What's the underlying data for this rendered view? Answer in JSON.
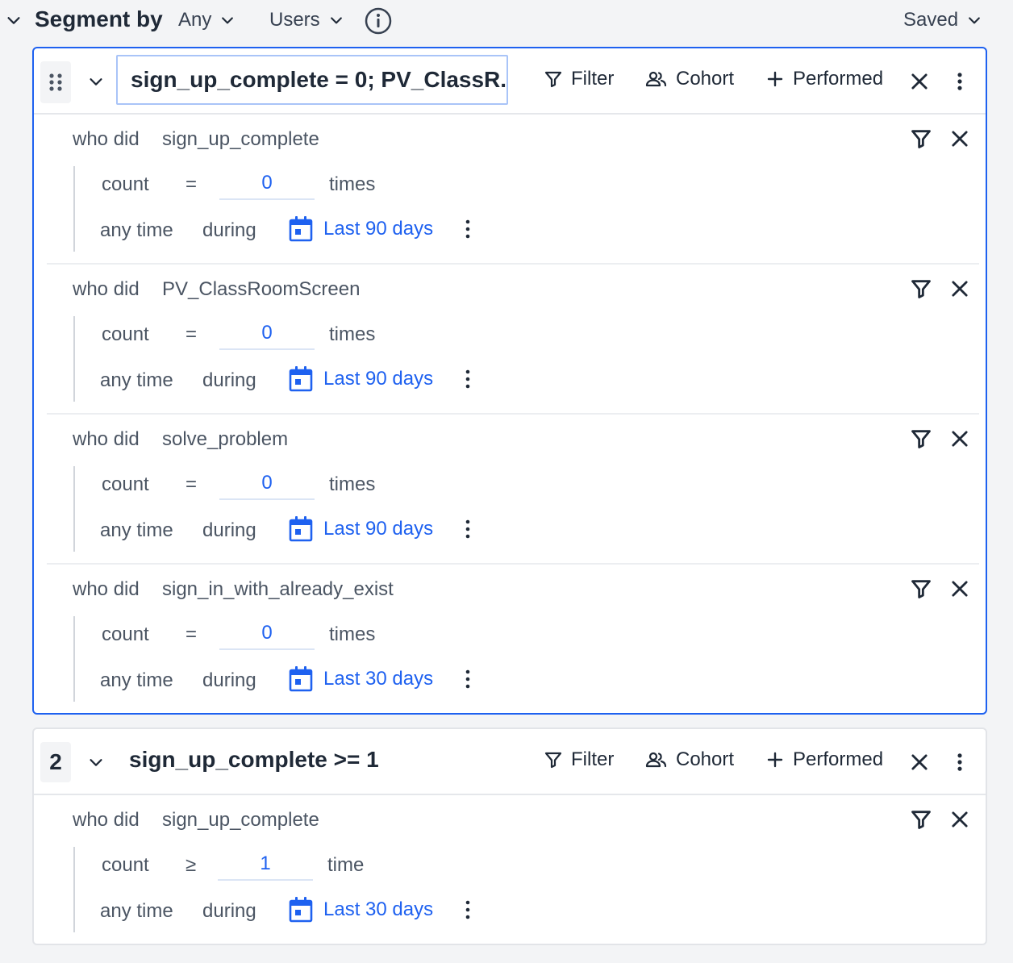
{
  "header": {
    "title": "Segment by",
    "any_label": "Any",
    "users_label": "Users",
    "saved_label": "Saved"
  },
  "actions": {
    "filter": "Filter",
    "cohort": "Cohort",
    "performed": "Performed"
  },
  "segments": [
    {
      "name": "sign_up_complete = 0; PV_ClassR...",
      "conditions": [
        {
          "who": "who did",
          "event": "sign_up_complete",
          "count_label": "count",
          "operator": "=",
          "value": "0",
          "unit": "times",
          "anytime": "any time",
          "during": "during",
          "range": "Last 90 days"
        },
        {
          "who": "who did",
          "event": "PV_ClassRoomScreen",
          "count_label": "count",
          "operator": "=",
          "value": "0",
          "unit": "times",
          "anytime": "any time",
          "during": "during",
          "range": "Last 90 days"
        },
        {
          "who": "who did",
          "event": "solve_problem",
          "count_label": "count",
          "operator": "=",
          "value": "0",
          "unit": "times",
          "anytime": "any time",
          "during": "during",
          "range": "Last 90 days"
        },
        {
          "who": "who did",
          "event": "sign_in_with_already_exist",
          "count_label": "count",
          "operator": "=",
          "value": "0",
          "unit": "times",
          "anytime": "any time",
          "during": "during",
          "range": "Last 30 days"
        }
      ]
    },
    {
      "number": "2",
      "name": "sign_up_complete >= 1",
      "conditions": [
        {
          "who": "who did",
          "event": "sign_up_complete",
          "count_label": "count",
          "operator": "≥",
          "value": "1",
          "unit": "time",
          "anytime": "any time",
          "during": "during",
          "range": "Last 30 days"
        }
      ]
    }
  ],
  "colors": {
    "accent": "#1e61f0",
    "background": "#f3f4f6",
    "card": "#ffffff",
    "text": "#1f2937",
    "muted": "#4b5563"
  },
  "icons": {
    "collapse": "chevron-down-icon",
    "info": "info-icon",
    "drag": "drag-handle-icon",
    "filter": "filter-icon",
    "cohort": "users-icon",
    "performed": "plus-icon",
    "remove": "close-icon",
    "more": "kebab-icon",
    "date": "calendar-icon"
  }
}
